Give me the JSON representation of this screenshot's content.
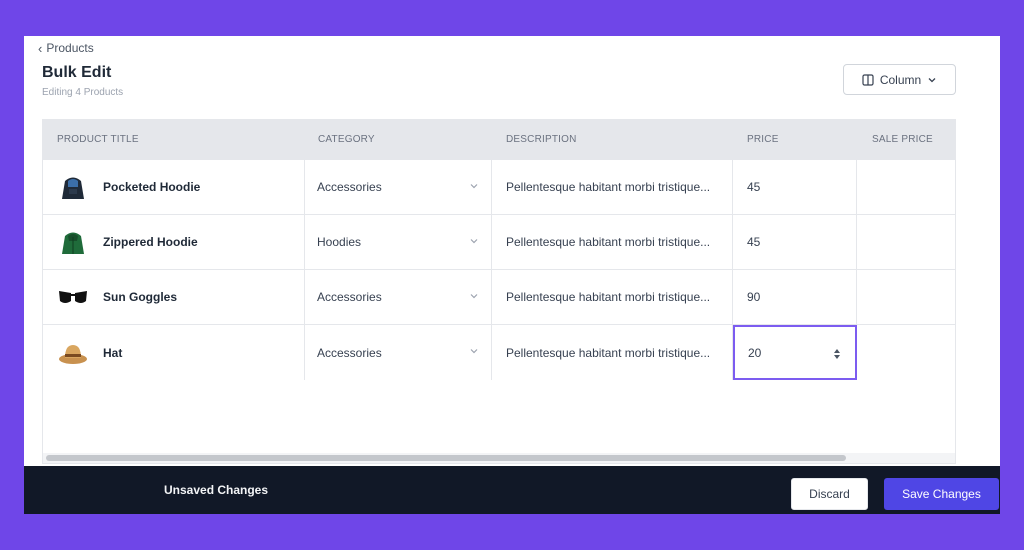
{
  "header": {
    "back_label": "Products",
    "title": "Bulk Edit",
    "subtitle": "Editing 4 Products",
    "column_button_label": "Column"
  },
  "table": {
    "columns": [
      "PRODUCT TITLE",
      "CATEGORY",
      "DESCRIPTION",
      "PRICE",
      "SALE PRICE"
    ],
    "rows": [
      {
        "title": "Pocketed Hoodie",
        "category": "Accessories",
        "description": "Pellentesque habitant morbi tristique...",
        "price": "45",
        "sale_price": "",
        "thumb_icon": "hoodie-dark-icon"
      },
      {
        "title": "Zippered Hoodie",
        "category": "Hoodies",
        "description": "Pellentesque habitant morbi tristique...",
        "price": "45",
        "sale_price": "",
        "thumb_icon": "hoodie-green-icon"
      },
      {
        "title": "Sun Goggles",
        "category": "Accessories",
        "description": "Pellentesque habitant morbi tristique...",
        "price": "90",
        "sale_price": "",
        "thumb_icon": "sunglasses-icon"
      },
      {
        "title": "Hat",
        "category": "Accessories",
        "description": "Pellentesque habitant morbi tristique...",
        "price": "20",
        "sale_price": "",
        "thumb_icon": "hat-icon"
      }
    ],
    "focused_row": 3
  },
  "footer": {
    "status": "Unsaved Changes",
    "discard_label": "Discard",
    "save_label": "Save Changes"
  },
  "colors": {
    "background": "#6f46e8",
    "primary": "#4f46e5",
    "footer": "#111827",
    "focus_ring": "#7c5cf0"
  }
}
